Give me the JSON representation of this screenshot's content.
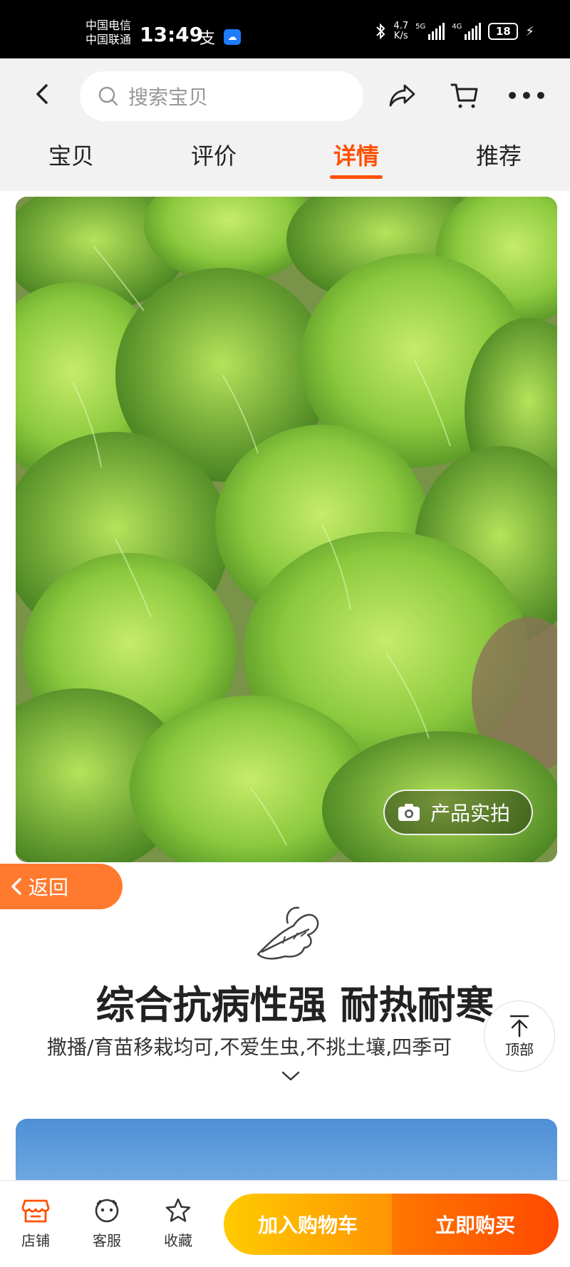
{
  "status_bar": {
    "carrier_1": "中国电信",
    "carrier_2": "中国联通",
    "time": "13:49",
    "net_speed_value": "4.7",
    "net_speed_unit": "K/s",
    "signal_1_label": "5G",
    "signal_2_label": "4G",
    "battery": "18"
  },
  "header": {
    "search_placeholder": "搜索宝贝",
    "tabs": [
      {
        "label": "宝贝"
      },
      {
        "label": "评价"
      },
      {
        "label": "详情"
      },
      {
        "label": "推荐"
      }
    ],
    "active_tab": "详情"
  },
  "content": {
    "photo_badge": "产品实拍",
    "return_label": "返回",
    "headline": "综合抗病性强 耐热耐寒",
    "subline": "撒播/育苗移栽均可,不爱生虫,不挑土壤,四季可",
    "top_label": "顶部"
  },
  "bottom_bar": {
    "store_label": "店铺",
    "service_label": "客服",
    "favorite_label": "收藏",
    "add_cart_label": "加入购物车",
    "buy_now_label": "立即购买"
  },
  "colors": {
    "accent": "#ff5000",
    "return_button": "#ff7a2e",
    "add_cart_gradient_start": "#ffcb00",
    "buy_now_gradient_end": "#ff4900"
  }
}
